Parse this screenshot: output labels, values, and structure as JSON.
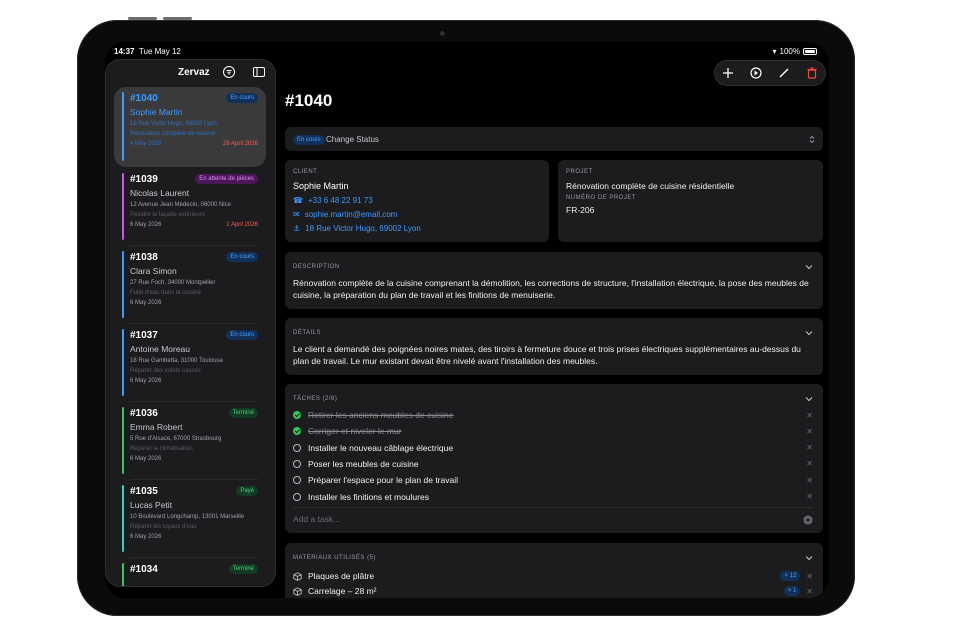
{
  "status_bar": {
    "time": "14:37",
    "date": "Tue May 12",
    "battery": "100%"
  },
  "sidebar": {
    "title": "Zervaz",
    "jobs": [
      {
        "number": "#1040",
        "badge": "En cours",
        "badge_color": "blue",
        "name": "Sophie Martin",
        "address": "18 Rue Victor Hugo, 69002 Lyon",
        "description": "Rénovation complète de cuisine",
        "date": "4 May 2026",
        "due": "29 April 2026",
        "bar_color": "#3d9bff",
        "selected": true
      },
      {
        "number": "#1039",
        "badge": "En attente de pièces",
        "badge_color": "purple",
        "name": "Nicolas Laurent",
        "address": "12 Avenue Jean Médecin, 06000 Nice",
        "description": "Peindre la façade extérieure",
        "date": "6 May 2026",
        "due": "1 April 2026",
        "bar_color": "#d94ef0"
      },
      {
        "number": "#1038",
        "badge": "En cours",
        "badge_color": "blue",
        "name": "Clara Simon",
        "address": "27 Rue Foch, 34000 Montpellier",
        "description": "Fuite d'eau dans la cuisine",
        "date": "6 May 2026",
        "due": "",
        "bar_color": "#3d9bff"
      },
      {
        "number": "#1037",
        "badge": "En cours",
        "badge_color": "blue",
        "name": "Antoine Moreau",
        "address": "18 Rue Gambetta, 31000 Toulouse",
        "description": "Réparer des volets cassés",
        "date": "6 May 2026",
        "due": "",
        "bar_color": "#3d9bff"
      },
      {
        "number": "#1036",
        "badge": "Terminé",
        "badge_color": "green",
        "name": "Emma Robert",
        "address": "5 Rue d'Alsace, 67000 Strasbourg",
        "description": "Réparer la climatisation",
        "date": "6 May 2026",
        "due": "",
        "bar_color": "#34c759"
      },
      {
        "number": "#1035",
        "badge": "Payé",
        "badge_color": "green",
        "name": "Lucas Petit",
        "address": "10 Boulevard Longchamp, 13001 Marseille",
        "description": "Réparer les tuyaux d'eau",
        "date": "6 May 2026",
        "due": "",
        "bar_color": "#2fd3c0"
      },
      {
        "number": "#1034",
        "badge": "Terminé",
        "badge_color": "green",
        "name": "",
        "address": "",
        "description": "",
        "date": "",
        "due": "",
        "bar_color": "#34c759"
      }
    ]
  },
  "main": {
    "title": "#1040",
    "status_pill": "En cours",
    "change_status_label": "Change Status",
    "client": {
      "caption": "CLIENT",
      "name": "Sophie Martin",
      "phone": "+33 6 48 22 91 73",
      "email": "sophie.martin@email.com",
      "address": "18 Rue Victor Hugo, 69002 Lyon"
    },
    "project": {
      "caption": "PROJET",
      "name": "Rénovation complète de cuisine résidentielle",
      "number_caption": "NUMÉRO DE PROJET",
      "number": "FR-206"
    },
    "description": {
      "caption": "DESCRIPTION",
      "text": "Rénovation complète de la cuisine comprenant la démolition, les corrections de structure, l'installation électrique, la pose des meubles de cuisine, la préparation du plan de travail et les finitions de menuiserie."
    },
    "details": {
      "caption": "DÉTAILS",
      "text": "Le client a demandé des poignées noires mates, des tiroirs à fermeture douce et trois prises électriques supplémentaires au-dessus du plan de travail. Le mur existant devait être nivelé avant l'installation des meubles."
    },
    "tasks": {
      "caption": "TÂCHES (2/6)",
      "items": [
        {
          "label": "Retirer les anciens meubles de cuisine",
          "done": true
        },
        {
          "label": "Corriger et niveler le mur",
          "done": true
        },
        {
          "label": "Installer le nouveau câblage électrique",
          "done": false
        },
        {
          "label": "Poser les meubles de cuisine",
          "done": false
        },
        {
          "label": "Préparer l'espace pour le plan de travail",
          "done": false
        },
        {
          "label": "Installer les finitions et moulures",
          "done": false
        }
      ],
      "add_placeholder": "Add a task..."
    },
    "materials": {
      "caption": "MATÉRIAUX UTILISÉS (5)",
      "items": [
        {
          "label": "Plaques de plâtre",
          "qty": "× 12"
        },
        {
          "label": "Carrelage – 28 m²",
          "qty": "× 1"
        }
      ]
    }
  },
  "colors": {
    "accent": "#3d9bff",
    "danger": "#ff453a",
    "success": "#34c759",
    "card": "#1c1c1e"
  }
}
